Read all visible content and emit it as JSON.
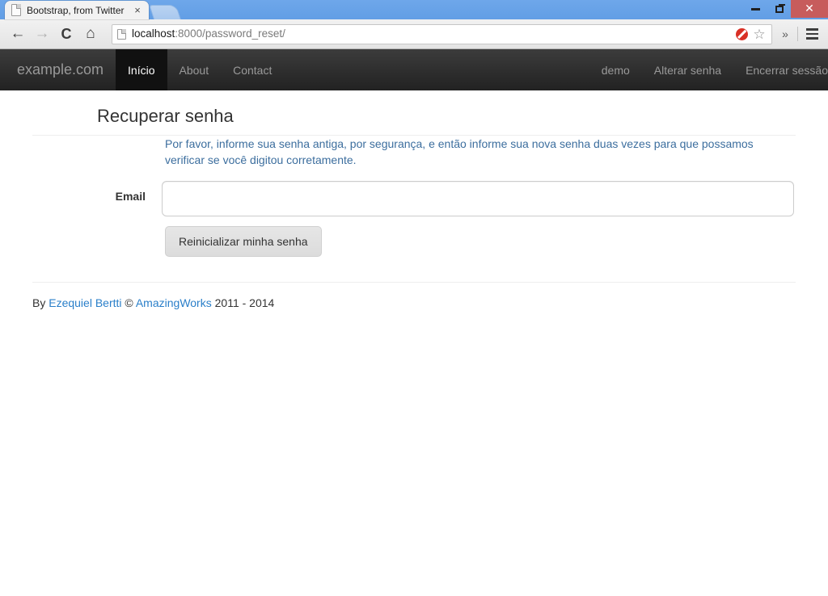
{
  "browser": {
    "tab": {
      "title": "Bootstrap, from Twitter",
      "favicon": "page-document-icon",
      "close_label": "×"
    },
    "newtab_label": "",
    "window_controls": {
      "minimize": "−",
      "maximize": "❐",
      "close": "✕"
    },
    "toolbar": {
      "back": "←",
      "forward": "→",
      "reload": "↻",
      "home": "⌂",
      "url_host": "localhost",
      "url_rest": ":8000/password_reset/",
      "url_full": "localhost:8000/password_reset/",
      "blocked_icon": "blocked-plugin-icon",
      "bookmark_icon": "☆",
      "overflow": "»",
      "menu": "hamburger-menu-icon"
    }
  },
  "navbar": {
    "brand": "example.com",
    "left_items": [
      {
        "label": "Início",
        "active": true
      },
      {
        "label": "About",
        "active": false
      },
      {
        "label": "Contact",
        "active": false
      }
    ],
    "right_items": [
      {
        "label": "demo"
      },
      {
        "label": "Alterar senha"
      },
      {
        "label": "Encerrar sessão"
      }
    ]
  },
  "page": {
    "heading": "Recuperar senha",
    "description": "Por favor, informe sua senha antiga, por segurança, e então informe sua nova senha duas vezes para que possamos verificar se você digitou corretamente.",
    "form": {
      "email_label": "Email",
      "email_value": "",
      "email_placeholder": "",
      "submit_label": "Reinicializar minha senha"
    },
    "footer": {
      "prefix": "By ",
      "author": "Ezequiel Bertti",
      "copyright_symbol": " © ",
      "company": "AmazingWorks",
      "years": " 2011 - 2014"
    }
  },
  "colors": {
    "navbar_dark": "#222222",
    "navbar_active": "#111111",
    "nav_text": "#999999",
    "help_text": "#3c6e9e",
    "link": "#2a7fc9",
    "tabstrip_blue": "#6ba4e7",
    "close_red": "#c75c5c"
  }
}
